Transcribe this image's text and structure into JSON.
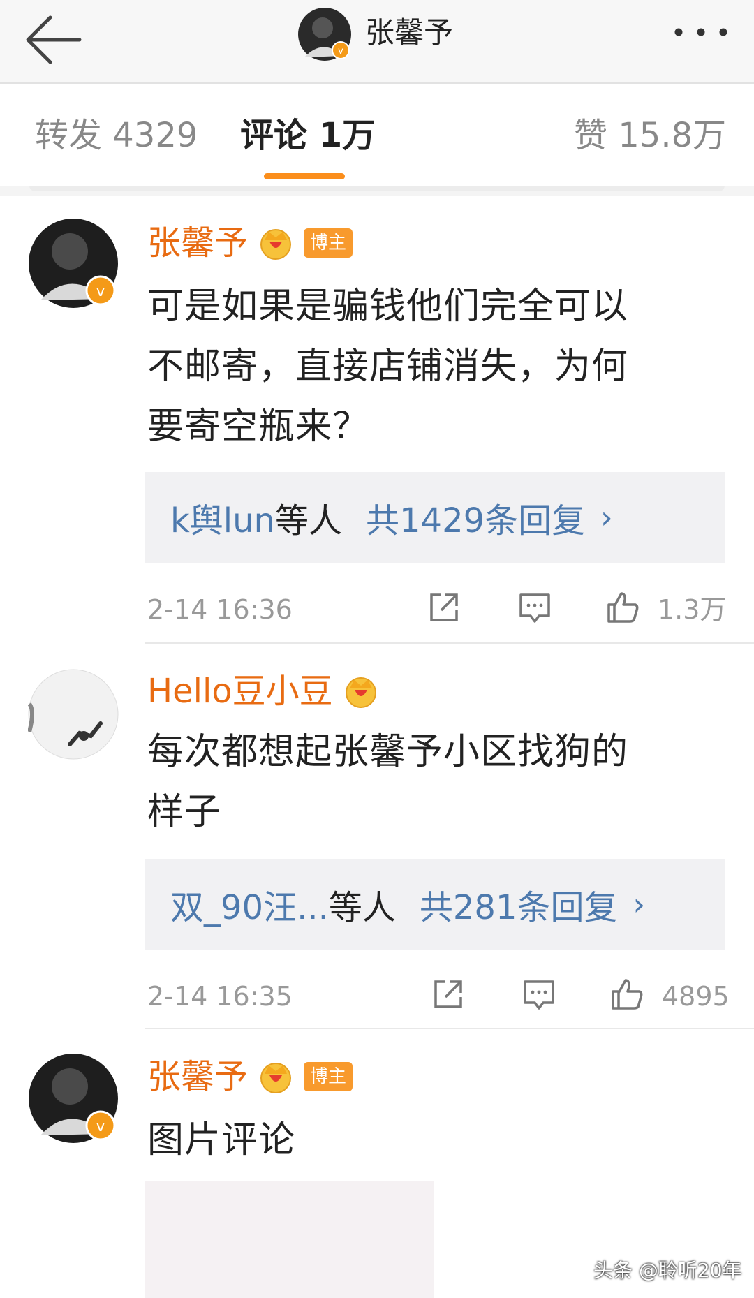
{
  "header": {
    "title": "张馨予",
    "back_icon": "back-arrow-icon",
    "more_icon": "more-dots-icon"
  },
  "tabs": [
    {
      "label": "转发 4329",
      "active": false
    },
    {
      "label": "评论 1万",
      "active": true
    },
    {
      "label": "赞 15.8万",
      "active": false
    }
  ],
  "comments": [
    {
      "username": "张馨予",
      "host_badge": "博主",
      "text_lines": [
        "可是如果是骗钱他们完全可以",
        "不邮寄，直接店铺消失，为何",
        "要寄空瓶来？"
      ],
      "reply_users": "k舆lun",
      "reply_suffix": "等人",
      "reply_count": "共1429条回复",
      "time": "2-14 16:36",
      "likes": "1.3万"
    },
    {
      "username": "Hello豆小豆",
      "text_lines": [
        "每次都想起张馨予小区找狗的",
        "样子"
      ],
      "reply_users": "双_90汪...",
      "reply_suffix": "等人",
      "reply_count": "共281条回复",
      "time": "2-14 16:35",
      "likes": "4895"
    },
    {
      "username": "张馨予",
      "host_badge": "博主",
      "text_lines": [
        "图片评论"
      ]
    }
  ],
  "watermark": "头条 @聆听20年",
  "colors": {
    "accent": "#fb8e1c",
    "username": "#e86b12",
    "link": "#4d79ad"
  }
}
